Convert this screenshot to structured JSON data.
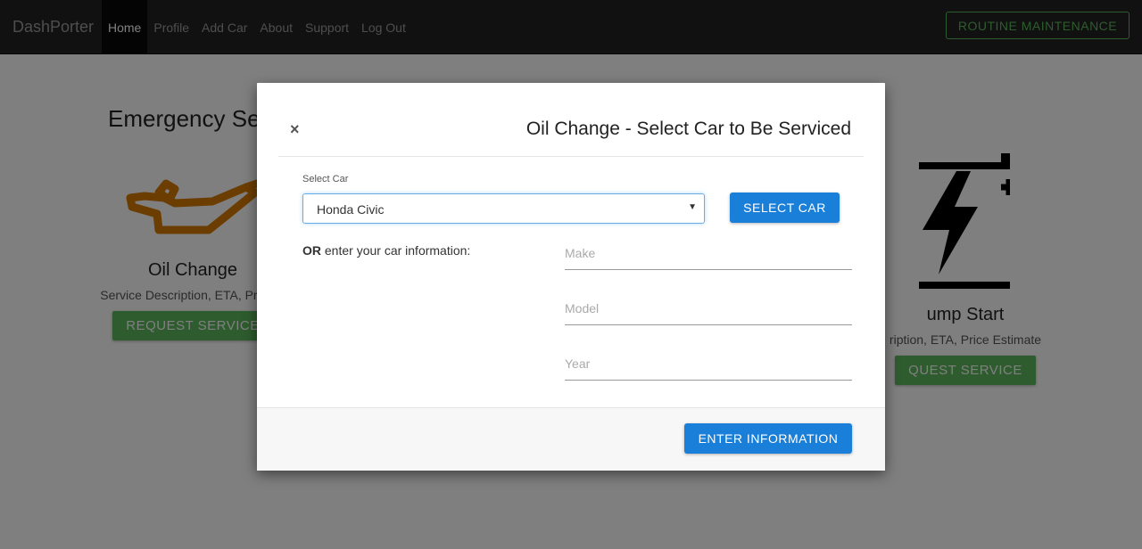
{
  "navbar": {
    "brand": "DashPorter",
    "items": [
      {
        "label": "Home",
        "active": true
      },
      {
        "label": "Profile"
      },
      {
        "label": "Add Car"
      },
      {
        "label": "About"
      },
      {
        "label": "Support"
      },
      {
        "label": "Log Out"
      }
    ],
    "routine_button": "ROUTINE MAINTENANCE"
  },
  "page": {
    "title": "Emergency Se",
    "services": [
      {
        "name": "Oil Change",
        "description": "Service Description, ETA, Price E",
        "button": "REQUEST SERVICE",
        "icon": "oil-can-icon",
        "icon_color": "#d97b00"
      },
      {
        "name": "ump Start",
        "description": "ription, ETA, Price Estimate",
        "button": "QUEST SERVICE",
        "icon": "battery-icon",
        "icon_color": "#000000"
      }
    ]
  },
  "modal": {
    "close": "×",
    "title": "Oil Change - Select Car to Be Serviced",
    "select_label": "Select Car",
    "selected_car": "Honda Civic",
    "select_button": "SELECT CAR",
    "or_bold": "OR",
    "or_text": " enter your car information:",
    "fields": {
      "make_placeholder": "Make",
      "model_placeholder": "Model",
      "year_placeholder": "Year"
    },
    "enter_button": "ENTER INFORMATION"
  },
  "colors": {
    "navbar_bg": "#222222",
    "success_green": "#5cb85c",
    "primary_blue": "#1a7fd8"
  }
}
